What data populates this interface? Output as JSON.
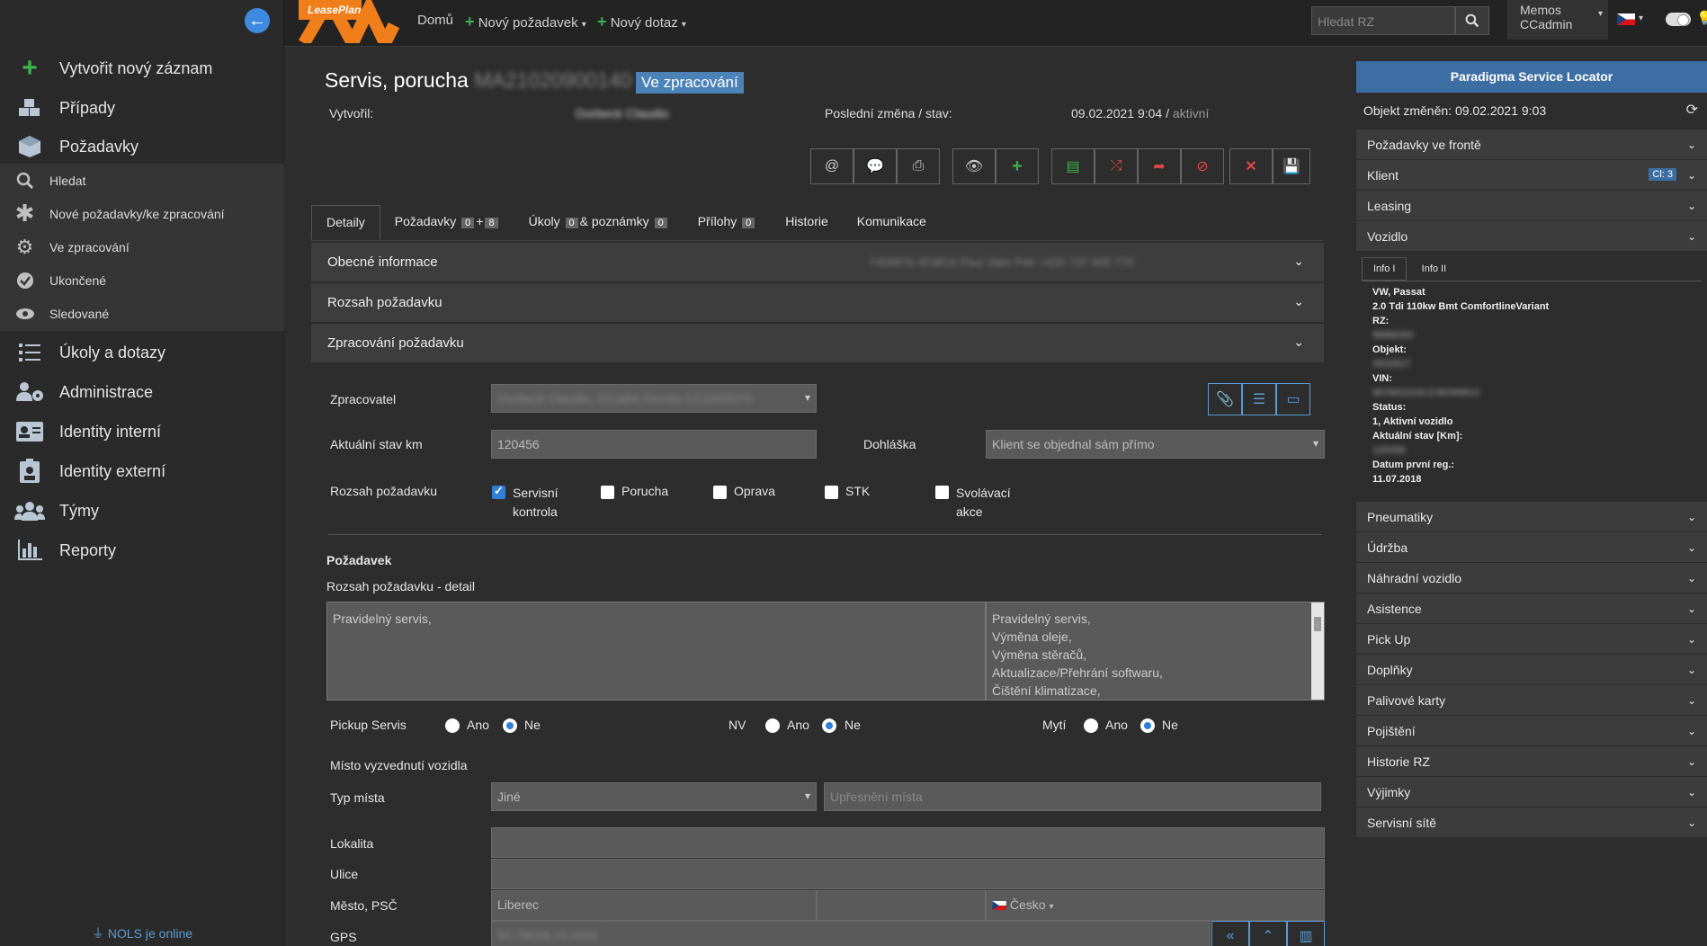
{
  "sidebar": {
    "items": [
      {
        "label": "Vytvořit nový záznam",
        "icon": "plus-icon"
      },
      {
        "label": "Případy",
        "icon": "cubes-icon"
      },
      {
        "label": "Požadavky",
        "icon": "cube-icon"
      }
    ],
    "subitems": [
      {
        "label": "Hledat",
        "icon": "search-icon"
      },
      {
        "label": "Nové požadavky/ke zpracování",
        "icon": "asterisk-icon"
      },
      {
        "label": "Ve zpracování",
        "icon": "gears-icon"
      },
      {
        "label": "Ukončené",
        "icon": "check-circle-icon"
      },
      {
        "label": "Sledované",
        "icon": "eye-icon"
      }
    ],
    "items2": [
      {
        "label": "Úkoly a dotazy",
        "icon": "tasks-icon"
      },
      {
        "label": "Administrace",
        "icon": "users-cog-icon"
      },
      {
        "label": "Identity interní",
        "icon": "id-card-icon"
      },
      {
        "label": "Identity externí",
        "icon": "id-badge-icon"
      },
      {
        "label": "Týmy",
        "icon": "team-icon"
      },
      {
        "label": "Reporty",
        "icon": "chart-bar-icon"
      }
    ],
    "online": "NOLS je online"
  },
  "topbar": {
    "logo": "LeasePlan",
    "home": "Domů",
    "new_request": "Nový požadavek",
    "new_query": "Nový dotaz",
    "search_placeholder": "Hledat RZ",
    "user_line1": "Memos",
    "user_line2": "CCadmin"
  },
  "header": {
    "title": "Servis, porucha",
    "request_id": "MA21020900140",
    "status": "Ve zpracování",
    "created_by_label": "Vytvořil:",
    "created_by": "Dorbeck Claudio",
    "last_change_label": "Poslední změna / stav:",
    "last_change": "09.02.2021 9:04 /",
    "last_state": "aktivní"
  },
  "tabs": [
    {
      "label": "Detaily"
    },
    {
      "label": "Požadavky",
      "c1": "0",
      "c2": "8"
    },
    {
      "label": "Úkoly",
      "c1": "0",
      "mid": "& poznámky",
      "c2": "0"
    },
    {
      "label": "Přílohy",
      "c1": "0"
    },
    {
      "label": "Historie"
    },
    {
      "label": "Komunikace"
    }
  ],
  "sections": {
    "general": "Obecné informace",
    "general_extra": "7456876 453816 Paul Jake Petr +420 737 905 770",
    "scope": "Rozsah požadavku",
    "processing": "Zpracování požadavku"
  },
  "form": {
    "processor_label": "Zpracovatel",
    "processor_value": "Dorbeck Claudio, CCadm Dorota CC2900070",
    "km_label": "Aktuální stav km",
    "km_value": "120456",
    "arrangement_label": "Dohláška",
    "arrangement_value": "Klient se objednal sám přímo",
    "scope_label": "Rozsah požadavku",
    "checks": [
      {
        "label1": "Servisní",
        "label2": "kontrola",
        "checked": true
      },
      {
        "label1": "Porucha",
        "label2": "",
        "checked": false
      },
      {
        "label1": "Oprava",
        "label2": "",
        "checked": false
      },
      {
        "label1": "STK",
        "label2": "",
        "checked": false
      },
      {
        "label1": "Svolávací",
        "label2": "akce",
        "checked": false
      }
    ],
    "request_heading": "Požadavek",
    "detail_label": "Rozsah požadavku - detail",
    "detail_left": "Pravidelný servis,",
    "detail_right": [
      "Pravidelný servis,",
      "Výměna oleje,",
      "Výměna stěračů,",
      "Aktualizace/Přehrání softwaru,",
      "Čištění klimatizace,"
    ],
    "pickup_label": "Pickup Servis",
    "nv_label": "NV",
    "wash_label": "Mytí",
    "yes": "Ano",
    "no": "Ne",
    "pickup_place": "Místo vyzvednutí vozidla",
    "place_type_label": "Typ místa",
    "place_type_value": "Jiné",
    "place_detail_placeholder": "Upřesnění místa",
    "locality_label": "Lokalita",
    "street_label": "Ulice",
    "city_label": "Město, PSČ",
    "city_value": "Liberec",
    "country": "Česko",
    "gps_label": "GPS",
    "gps_value": "50.76628,15.0591"
  },
  "right_panel": {
    "title": "Paradigma Service Locator",
    "object_changed": "Objekt změněn: 09.02.2021 9:03",
    "sections_top": [
      "Požadavky ve frontě",
      "Klient",
      "Leasing",
      "Vozidlo"
    ],
    "client_badge": "Cl: 3",
    "vehicle_tabs": [
      "Info I",
      "Info II"
    ],
    "vehicle_info": {
      "model": "VW, Passat",
      "engine": "2.0 Tdi 110kw Bmt ComfortlineVariant",
      "rz_label": "RZ:",
      "rz": "9M88393",
      "object_label": "Objekt:",
      "object": "4532817",
      "vin_label": "VIN:",
      "vin": "WVWZZZ3CZJE099812",
      "status_label": "Status:",
      "status": "1, Aktivní vozidlo",
      "km_label": "Aktuální stav [Km]:",
      "km": "120456",
      "first_reg_label": "Datum první reg.:",
      "first_reg": "11.07.2018"
    },
    "sections_bottom": [
      "Pneumatiky",
      "Údržba",
      "Náhradní vozidlo",
      "Asistence",
      "Pick Up",
      "Doplňky",
      "Palivové karty",
      "Pojištění",
      "Historie RZ",
      "Výjimky",
      "Servisní sítě"
    ]
  }
}
